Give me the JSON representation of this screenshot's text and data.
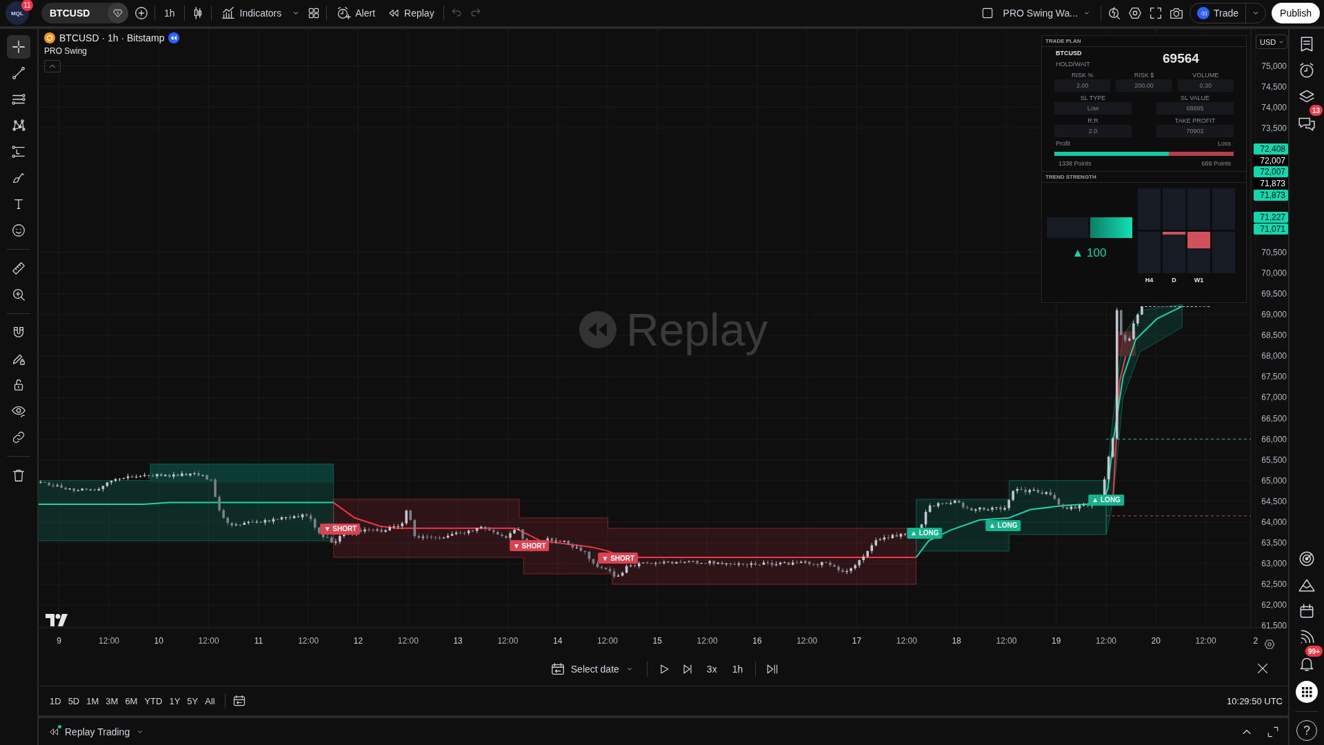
{
  "top_bar": {
    "avatar_text": "MQL",
    "notification_badge": "11",
    "symbol": "BTCUSD",
    "interval": "1h",
    "indicators": "Indicators",
    "alert": "Alert",
    "replay": "Replay",
    "layout_name": "PRO Swing Wa...",
    "trade": "Trade",
    "publish": "Publish"
  },
  "left_toolbar": [
    {
      "selected": true
    },
    {
      "selected": false
    },
    {
      "selected": false
    },
    {
      "selected": false
    },
    {
      "selected": false
    },
    {
      "selected": false
    },
    {
      "selected": false
    },
    {
      "selected": false
    },
    {
      "selected": false
    },
    {
      "selected": false
    },
    {
      "selected": false
    },
    {
      "selected": false
    },
    {
      "selected": false
    },
    {
      "selected": false
    },
    {
      "selected": false
    },
    {
      "selected": false
    }
  ],
  "legend": {
    "title": "BTCUSD · 1h · Bitstamp",
    "indicator": "PRO Swing"
  },
  "watermark": "Replay",
  "currency": "USD",
  "trade_plan": {
    "title": "TRADE PLAN",
    "symbol": "BTCUSD",
    "status": "HOLD/WAIT",
    "price": "69564",
    "fields": [
      {
        "label": "RISK %",
        "value": "2.00"
      },
      {
        "label": "RISK $",
        "value": "200.00"
      },
      {
        "label": "VOLUME",
        "value": "0.30"
      },
      {
        "label": "SL TYPE",
        "value": "Low"
      },
      {
        "label": "SL VALUE",
        "value": "68895"
      },
      {
        "label": "R:R",
        "value": "2.0"
      },
      {
        "label": "TAKE PROFIT",
        "value": "70902"
      }
    ],
    "profit_label": "Profit",
    "loss_label": "Loss",
    "profit_loss_bar": {
      "level": 0.64
    },
    "profit_points": "1338 Points",
    "loss_points": "669 Points"
  },
  "trend_strength": {
    "title": "TREND STRENGTH",
    "reading": "▲ 100",
    "timeframes": [
      {
        "label": "H4",
        "kind": "neutral"
      },
      {
        "label": "D",
        "kind": "weakbear"
      },
      {
        "label": "W1",
        "kind": "bear"
      },
      {
        "kind": "neutral"
      }
    ]
  },
  "signals": [
    {
      "kind": "short",
      "text": "▼ SHORT"
    },
    {
      "kind": "short",
      "text": "▼ SHORT"
    },
    {
      "kind": "short",
      "text": "▼ SHORT"
    },
    {
      "kind": "long",
      "text": "▲ LONG"
    },
    {
      "kind": "long",
      "text": "▲ LONG"
    },
    {
      "kind": "long",
      "text": "▲ LONG"
    }
  ],
  "price_axis": [
    "75,000",
    "74,500",
    "74,000",
    "73,500",
    "70,500",
    "70,000",
    "69,500",
    "69,000",
    "68,500",
    "68,000",
    "67,500",
    "67,000",
    "66,500",
    "66,000",
    "65,500",
    "65,000",
    "64,500",
    "64,000",
    "63,500",
    "63,000",
    "62,500",
    "62,000",
    "61,500"
  ],
  "price_labels": [
    {
      "kind": "marker",
      "text": "72,408"
    },
    {
      "kind": "last",
      "text": "72,007"
    },
    {
      "kind": "marker",
      "text": "72,007"
    },
    {
      "kind": "last",
      "text": "71,873"
    },
    {
      "kind": "marker",
      "text": "71,873"
    },
    {
      "kind": "marker",
      "text": "71,227"
    },
    {
      "kind": "marker",
      "text": "71,071"
    }
  ],
  "time_axis": [
    "9",
    "12:00",
    "10",
    "12:00",
    "11",
    "12:00",
    "12",
    "12:00",
    "13",
    "12:00",
    "14",
    "12:00",
    "15",
    "12:00",
    "16",
    "12:00",
    "17",
    "12:00",
    "18",
    "12:00",
    "19",
    "12:00",
    "20",
    "12:00",
    "2"
  ],
  "replay_bar": {
    "select_date": "Select date",
    "speed": "3x",
    "interval": "1h"
  },
  "ranges": [
    "1D",
    "5D",
    "1M",
    "3M",
    "6M",
    "YTD",
    "1Y",
    "5Y",
    "All"
  ],
  "clock": "10:29:50 UTC",
  "bottom_panel": {
    "title": "Replay Trading"
  },
  "right_sidebar": {
    "chat_badge": "13",
    "alerts_badge": "99+",
    "help": "?"
  }
}
